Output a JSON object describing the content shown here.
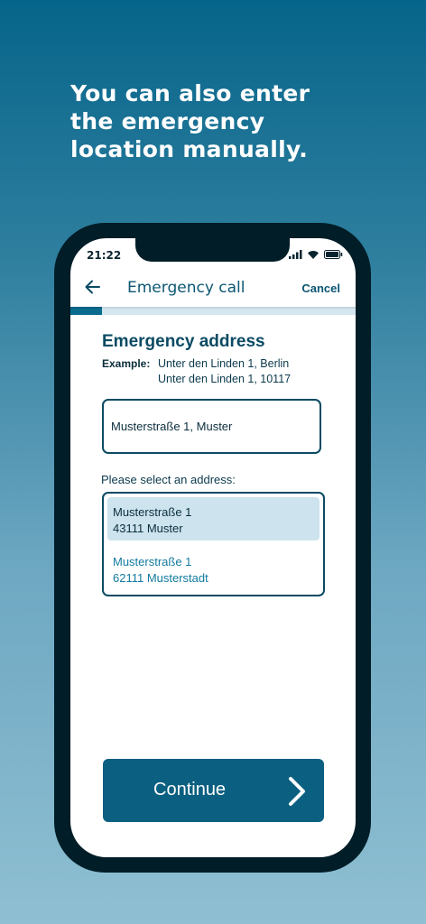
{
  "headline": "You can also enter the emergency location manually.",
  "status_bar": {
    "time": "21:22",
    "icons": [
      "signal-icon",
      "wifi-icon",
      "battery-icon"
    ]
  },
  "topbar": {
    "title": "Emergency call",
    "cancel_label": "Cancel",
    "back_icon": "arrow-left-icon"
  },
  "progress": {
    "fraction": 0.11
  },
  "form": {
    "title": "Emergency address",
    "example_label": "Example:",
    "example_lines": [
      "Unter den Linden 1, Berlin",
      "Unter den Linden 1, 10117"
    ],
    "input_value": "Musterstraße 1, Muster",
    "select_label": "Please select an address:",
    "suggestions": [
      {
        "line1": "Musterstraße 1",
        "line2": "43111 Muster",
        "selected": true
      },
      {
        "line1": "Musterstraße 1",
        "line2": "62111 Musterstadt",
        "selected": false
      }
    ]
  },
  "continue_button": {
    "label": "Continue",
    "icon": "chevron-right-icon"
  },
  "colors": {
    "primary": "#0b5f80",
    "accent": "#127a9f",
    "selected_bg": "#cde3ee",
    "phone_frame": "#011d27"
  }
}
